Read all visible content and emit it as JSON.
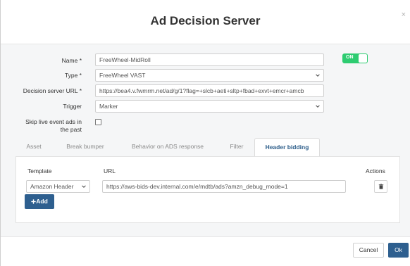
{
  "modal": {
    "title": "Ad Decision Server",
    "close_glyph": "×"
  },
  "form": {
    "name_label": "Name *",
    "name_value": "FreeWheel-MidRoll",
    "toggle_label": "ON",
    "type_label": "Type *",
    "type_value": "FreeWheel VAST",
    "url_label": "Decision server URL *",
    "url_value": "https://bea4.v.fwmrm.net/ad/g/1?flag=+slcb+aeti+sltp+fbad+exvt+emcr+amcb",
    "trigger_label": "Trigger",
    "trigger_value": "Marker",
    "skip_label_line1": "Skip live event ads in",
    "skip_label_line2": "the past",
    "skip_checked": false
  },
  "tabs": [
    {
      "label": "Asset",
      "active": false
    },
    {
      "label": "Break bumper",
      "active": false
    },
    {
      "label": "Behavior on ADS response",
      "active": false
    },
    {
      "label": "Filter",
      "active": false
    },
    {
      "label": "Header bidding",
      "active": true
    }
  ],
  "header_bidding": {
    "col_template": "Template",
    "col_url": "URL",
    "col_actions": "Actions",
    "rows": [
      {
        "template": "Amazon Header",
        "url": "https://aws-bids-dev.internal.com/e/mdtb/ads?amzn_debug_mode=1"
      }
    ],
    "add_label": "Add"
  },
  "footer": {
    "cancel_label": "Cancel",
    "ok_label": "Ok"
  },
  "colors": {
    "primary": "#2e5f8f",
    "toggle_on": "#2ecc71",
    "active_tab_text": "#2c5d8a"
  },
  "icons": {
    "select_arrow": "chevron-down-icon",
    "delete": "trash-icon",
    "add": "plus-icon",
    "close": "close-icon"
  }
}
